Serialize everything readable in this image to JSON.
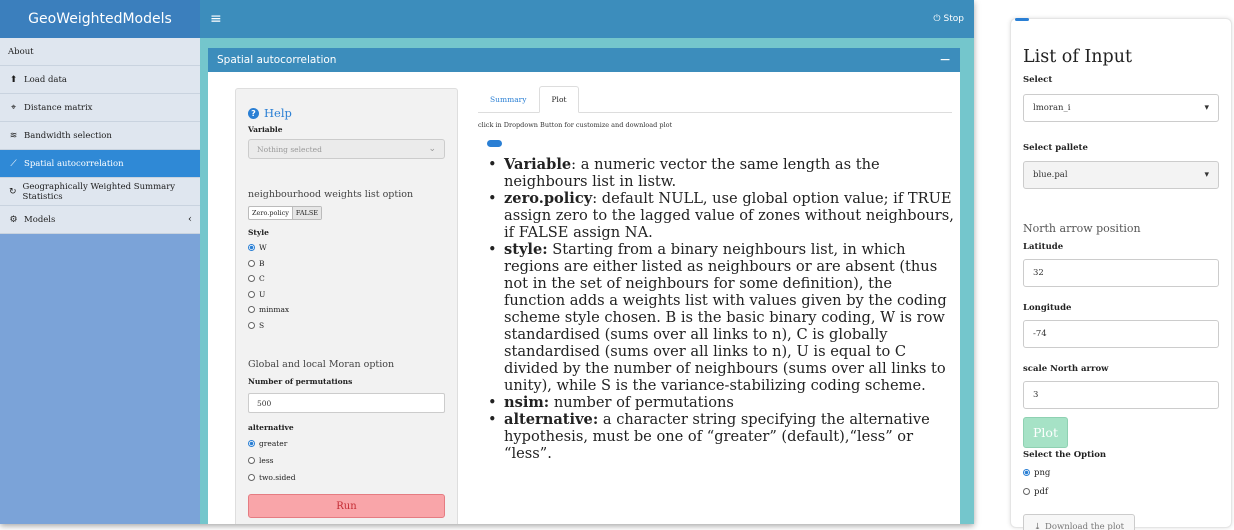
{
  "app": {
    "brand": "GeoWeightedModels",
    "stop_label": "Stop"
  },
  "sidebar": {
    "items": [
      {
        "label": "About",
        "icon": ""
      },
      {
        "label": "Load data",
        "icon": "file-upload-icon"
      },
      {
        "label": "Distance matrix",
        "icon": "map-pin-icon"
      },
      {
        "label": "Bandwidth selection",
        "icon": "wifi-icon"
      },
      {
        "label": "Spatial autocorrelation",
        "icon": "line-chart-icon",
        "active": true
      },
      {
        "label": "Geographically Weighted Summary Statistics",
        "icon": "circle-arrow-icon"
      },
      {
        "label": "Models",
        "icon": "gear-icon"
      }
    ]
  },
  "box": {
    "title": "Spatial autocorrelation",
    "collapse_symbol": "−"
  },
  "well": {
    "help": "Help",
    "variable_label": "Variable",
    "variable_placeholder": "Nothing selected",
    "nb_title": "neighbourhood weights list option",
    "zero_policy_label": "Zero.policy",
    "zero_policy_value": "FALSE",
    "style_label": "Style",
    "style_options": [
      "W",
      "B",
      "C",
      "U",
      "minmax",
      "S"
    ],
    "style_selected": "W",
    "moran_title": "Global and local Moran option",
    "perm_label": "Number of permutations",
    "perm_value": "500",
    "alt_label": "alternative",
    "alt_options": [
      "greater",
      "less",
      "two.sided"
    ],
    "alt_selected": "greater",
    "run": "Run"
  },
  "tabs": [
    "Summary",
    "Plot"
  ],
  "active_tab": "Plot",
  "hint": "click in Dropdown Button for customize and download plot",
  "doc": [
    {
      "term": "Variable",
      "sep": ":",
      "text": " a numeric vector the same length as the neighbours list in listw."
    },
    {
      "term": "zero.policy",
      "sep": ":",
      "text": " default NULL, use global option value; if TRUE assign zero to the lagged value of zones without neighbours, if FALSE assign NA."
    },
    {
      "term": "style:",
      "sep": "",
      "text": " Starting from a binary neighbours list, in which regions are either listed as neighbours or are absent (thus not in the set of neighbours for some definition), the function adds a weights list with values given by the coding scheme style chosen. B is the basic binary coding, W is row standardised (sums over all links to n), C is globally standardised (sums over all links to n), U is equal to C divided by the number of neighbours (sums over all links to unity), while S is the variance-stabilizing coding scheme."
    },
    {
      "term": "nsim:",
      "sep": "",
      "text": " number of permutations"
    },
    {
      "term": "alternative:",
      "sep": "",
      "text": " a character string specifying the alternative hypothesis, must be one of “greater” (default),“less” or “less”."
    }
  ],
  "side": {
    "title": "List of Input",
    "select_label": "Select",
    "select_value": "lmoran_i",
    "pallete_label": "Select pallete",
    "pallete_value": "blue.pal",
    "arrow_title": "North arrow position",
    "lat_label": "Latitude",
    "lat_value": "32",
    "lon_label": "Longitude",
    "lon_value": "-74",
    "scale_label": "scale North arrow",
    "scale_value": "3",
    "plot_button": "Plot",
    "option_label": "Select the Option",
    "options": [
      "png",
      "pdf"
    ],
    "option_selected": "png",
    "download": "Download the plot"
  },
  "colors": {
    "header_blue": "#3c8dbc",
    "active_nav": "#2f89d6",
    "content_bg": "#74c6cc",
    "run_button": "#f9a5a9",
    "plot_button": "#a6e2c6"
  }
}
